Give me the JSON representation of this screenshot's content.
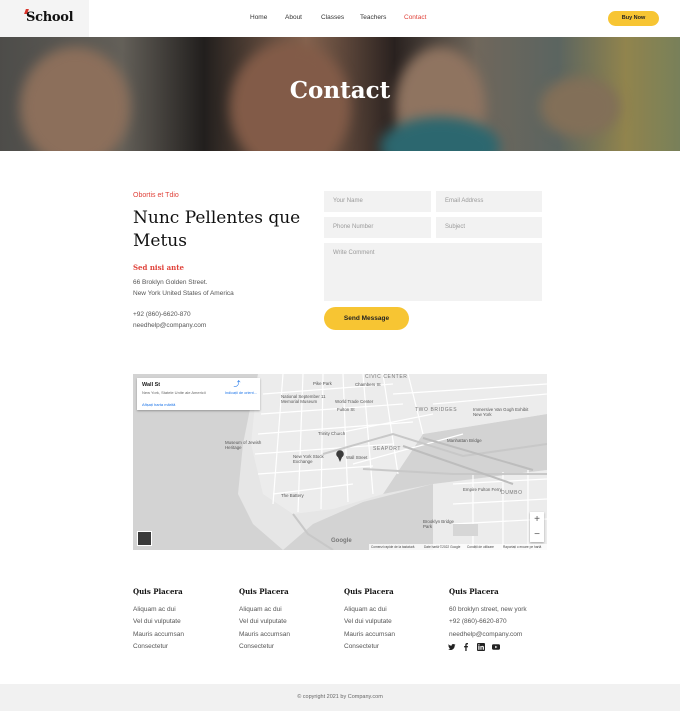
{
  "header": {
    "logo": "School",
    "nav": [
      {
        "label": "Home",
        "active": false
      },
      {
        "label": "About",
        "active": false
      },
      {
        "label": "Classes",
        "active": false
      },
      {
        "label": "Teachers",
        "active": false
      },
      {
        "label": "Contact",
        "active": true
      }
    ],
    "buy_button": "Buy Now"
  },
  "hero": {
    "title": "Contact"
  },
  "contact": {
    "eyebrow": "Obortis et Tdio",
    "title": "Nunc Pellentes que Metus",
    "sub_heading": "Sed nisi ante",
    "address_line1": "66 Broklyn Golden Street.",
    "address_line2": "New York United States of America",
    "phone": "+92 (860)-6620-870",
    "email": "needhelp@company.com"
  },
  "form": {
    "name_placeholder": "Your Name",
    "email_placeholder": "Email Address",
    "phone_placeholder": "Phone Number",
    "subject_placeholder": "Subject",
    "comment_placeholder": "Write Comment",
    "send_label": "Send Message"
  },
  "map": {
    "place_title": "Wall St",
    "place_subtitle": "New York, Statele Unite ale Americii",
    "directions_label": "Indicații de orient...",
    "larger_map_link": "Afișați harta mărită",
    "labels": {
      "civic_center": "CIVIC CENTER",
      "two_bridges": "TWO BRIDGES",
      "seaport": "SEAPORT",
      "dumbo": "DUMBO",
      "tribeca_park": "Pike Park",
      "memorial": "National September 11 Memorial Museum",
      "wtc": "World Trade Center",
      "chambers": "Chambers St",
      "fulton": "Fulton St",
      "trinity": "Trinity Church",
      "nyse": "New York Stock Exchange",
      "wall_st": "Wall Street",
      "battery": "The Battery",
      "brooklyn_bridge": "Brooklyn Bridge Park",
      "manhattan_bridge": "Manhattan Bridge",
      "empire_park": "Empire Fulton Ferry",
      "van_gogh": "Immersive Van Gogh Exhibit New York",
      "ellis": "Museum of Jewish Heritage"
    },
    "zoom_in": "+",
    "zoom_out": "−",
    "google": "Google",
    "footer": [
      "Comenzi rapide de la tastatură",
      "Date hartă ©2022 Google",
      "Condiții de utilizare",
      "Raportați o eroare pe hartă"
    ]
  },
  "footer": {
    "columns": [
      {
        "title": "Quis Placera",
        "links": [
          "Aliquam ac dui",
          "Vel dui vulputate",
          "Mauris accumsan",
          "Consectetur"
        ]
      },
      {
        "title": "Quis Placera",
        "links": [
          "Aliquam ac dui",
          "Vel dui vulputate",
          "Mauris accumsan",
          "Consectetur"
        ]
      },
      {
        "title": "Quis Placera",
        "links": [
          "Aliquam ac dui",
          "Vel dui vulputate",
          "Mauris accumsan",
          "Consectetur"
        ]
      },
      {
        "title": "Quis Placera",
        "links": [
          "60 broklyn street, new york",
          "+92 (860)-6620-870",
          "needhelp@company.com"
        ]
      }
    ],
    "social_icons": [
      "twitter-icon",
      "facebook-icon",
      "linkedin-icon",
      "youtube-icon"
    ],
    "copyright": "© copyright 2021 by Company.com"
  },
  "colors": {
    "accent": "#e0433b",
    "button": "#f7c533",
    "field_bg": "#f2f2f2",
    "footer_bar": "#f1f1f1"
  }
}
